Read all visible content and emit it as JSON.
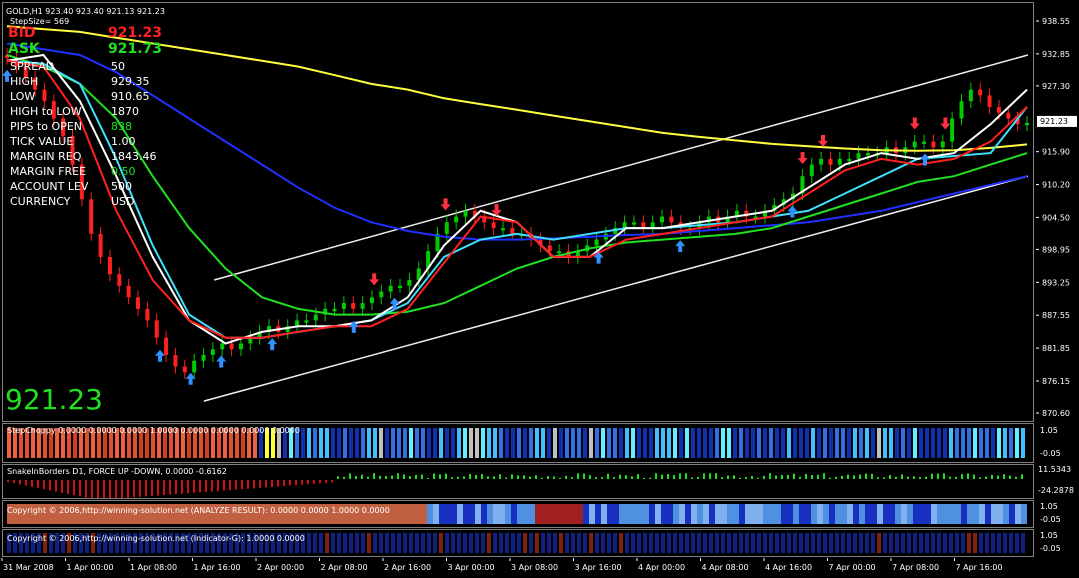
{
  "header": {
    "symbol": "GOLD,H1  923.40 923.40 921.13 921.23",
    "stepsize": "StepSize= 569"
  },
  "info": {
    "bid_label": "BID",
    "bid_value": "921.23",
    "ask_label": "ASK",
    "ask_value": "921.73",
    "rows": [
      {
        "label": "SPREAD",
        "value": "50"
      },
      {
        "label": "HIGH",
        "value": "929.35"
      },
      {
        "label": "LOW",
        "value": "910.65"
      },
      {
        "label": "HIGH to LOW",
        "value": "1870"
      },
      {
        "label": "PIPS to OPEN",
        "value": "838"
      },
      {
        "label": "TICK VALUE",
        "value": "1.00"
      },
      {
        "label": "MARGIN REQ",
        "value": "1843.46"
      },
      {
        "label": "MARGIN FREE",
        "value": "0.50"
      },
      {
        "label": "ACCOUNT LEV",
        "value": "500"
      },
      {
        "label": "CURRENCY",
        "value": "USD"
      }
    ],
    "big_price": "921.23"
  },
  "colors": {
    "bid": "#ff2020",
    "ask": "#20e020",
    "big_price": "#20e020",
    "bull": "#00cc00",
    "bear": "#ff2020"
  },
  "chart_data": {
    "type": "line",
    "price_scale": [
      "938.55",
      "932.85",
      "927.30",
      "921.23",
      "915.90",
      "910.20",
      "904.50",
      "898.95",
      "893.25",
      "887.55",
      "881.85",
      "876.15",
      "870.60"
    ],
    "current_price": "921.23",
    "ylim": [
      870.6,
      938.55
    ],
    "time_labels": [
      "31 Mar 2008",
      "1 Apr 00:00",
      "1 Apr 08:00",
      "1 Apr 16:00",
      "2 Apr 00:00",
      "2 Apr 08:00",
      "2 Apr 16:00",
      "3 Apr 00:00",
      "3 Apr 08:00",
      "3 Apr 16:00",
      "4 Apr 00:00",
      "4 Apr 08:00",
      "4 Apr 16:00",
      "7 Apr 00:00",
      "7 Apr 08:00",
      "7 Apr 16:00"
    ],
    "close": [
      932.5,
      931,
      929,
      927,
      925,
      922,
      919,
      914,
      908,
      902,
      898,
      895,
      893,
      891,
      889,
      887,
      884,
      881,
      879,
      878,
      880,
      881,
      882,
      883,
      882,
      883,
      884,
      885,
      886,
      885,
      886,
      887,
      887,
      888,
      889,
      889,
      890,
      889,
      890,
      891,
      892,
      893,
      893,
      894,
      896,
      899,
      902,
      904,
      905,
      906,
      905,
      904,
      903,
      903,
      902,
      902,
      901,
      900,
      899,
      899,
      898,
      899,
      900,
      901,
      902,
      903,
      904,
      904,
      903,
      904,
      905,
      904,
      903,
      903,
      904,
      905,
      904,
      905,
      906,
      905,
      905,
      906,
      907,
      908,
      909,
      912,
      914,
      915,
      914,
      915,
      915,
      916,
      916,
      916,
      917,
      916,
      917,
      918,
      918,
      917,
      918,
      922,
      925,
      927,
      926,
      924,
      923,
      922,
      921,
      921.23
    ],
    "series": [
      {
        "name": "MA yellow",
        "color": "#ffff40",
        "values": [
          938,
          937.5,
          937,
          936,
          935,
          934,
          933,
          932,
          931,
          929.5,
          928,
          927,
          925.5,
          924.5,
          923.5,
          922.5,
          921.5,
          920.5,
          919.5,
          918.8,
          918.2,
          917.6,
          917.2,
          916.8,
          916.5,
          916.4,
          916.5,
          916.9,
          917.5
        ]
      },
      {
        "name": "MA blue",
        "color": "#2030ff",
        "values": [
          935,
          934,
          933,
          930,
          926,
          922,
          918,
          914,
          910,
          906.5,
          904,
          902.5,
          901.5,
          901,
          901,
          901.2,
          901.5,
          901.8,
          902,
          902.5,
          903,
          903.5,
          904,
          905,
          906,
          907.5,
          909,
          910.5,
          912
        ]
      },
      {
        "name": "MA green",
        "color": "#20e020",
        "values": [
          933,
          931,
          928,
          922,
          912,
          903,
          896,
          891,
          889,
          888,
          888,
          888.5,
          890,
          893,
          896,
          898,
          899.5,
          900.5,
          901,
          901.5,
          902,
          903,
          905,
          907,
          909,
          911,
          912,
          914,
          916
        ]
      },
      {
        "name": "MA cyan",
        "color": "#40e0ff",
        "values": [
          932,
          931.5,
          928,
          915,
          900,
          888,
          884,
          884,
          885,
          886,
          887,
          890,
          898,
          901,
          902,
          901,
          902,
          903,
          903,
          903.5,
          904,
          905,
          906,
          909,
          912,
          915,
          915.5,
          916,
          924
        ]
      },
      {
        "name": "MA white",
        "color": "#ffffff",
        "values": [
          932,
          933,
          925,
          912,
          898,
          887,
          883,
          885,
          886,
          886,
          887,
          891,
          900,
          906,
          904,
          898,
          898,
          903,
          903,
          904,
          905,
          906,
          910,
          914,
          916,
          915,
          916,
          921,
          927
        ]
      },
      {
        "name": "MA red",
        "color": "#ff2020",
        "values": [
          932,
          931,
          922,
          906,
          894,
          887,
          884,
          884,
          885,
          886,
          886,
          889,
          897,
          905,
          904,
          898,
          898,
          901,
          902,
          903,
          904,
          905,
          909,
          913,
          915,
          914,
          915,
          918,
          924
        ]
      }
    ],
    "channel": {
      "upper": [
        [
          894,
          0.205
        ],
        [
          933,
          0.995
        ]
      ],
      "lower": [
        [
          873,
          0.195
        ],
        [
          912,
          0.995
        ]
      ],
      "color": "#f0f0f0"
    },
    "arrows_up_at": [
      0.0,
      0.15,
      0.18,
      0.21,
      0.26,
      0.34,
      0.38,
      0.58,
      0.66,
      0.77,
      0.9
    ],
    "arrows_down_at": [
      0.43,
      0.48,
      0.36,
      0.8,
      0.78,
      0.89,
      0.92
    ]
  },
  "indicators": [
    {
      "label": "StepChoppy 0.0000 0.0000 0.0000 1.0000 0.0000 0.0000 0.0000 0.0000",
      "scale": [
        "1.05",
        "-0.05"
      ]
    },
    {
      "label": "SnakeInBorders D1, FORCE UP -DOWN, 0.0000 -0.6162",
      "scale": [
        "11.5343",
        "-24.2878"
      ]
    },
    {
      "label": "Copyright © 2006,http://winning-solution.net (ANALYZE RESULT): 0.0000 0.0000 1.0000 0.0000",
      "scale": [
        "1.05",
        "-0.05"
      ]
    },
    {
      "label": "Copyright © 2006,http://winning-solution.net (Indicator-G): 1.0000 0.0000",
      "scale": [
        "1.05",
        "-0.05"
      ]
    }
  ]
}
